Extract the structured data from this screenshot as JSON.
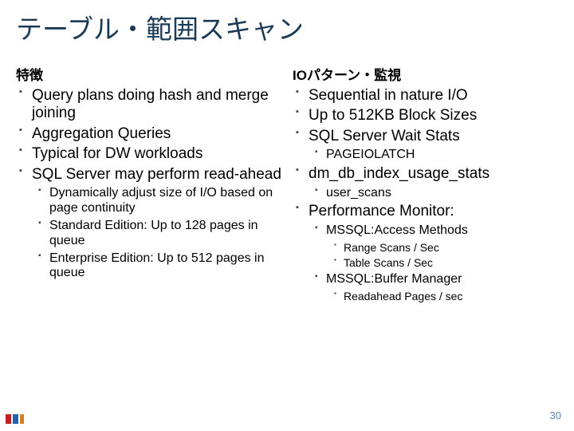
{
  "title": "テーブル・範囲スキャン",
  "left": {
    "heading": "特徴",
    "items": [
      {
        "text": "Query plans doing hash and merge joining"
      },
      {
        "text": "Aggregation Queries"
      },
      {
        "text": "Typical for DW workloads"
      },
      {
        "text": "SQL Server may perform read-ahead",
        "sub": [
          {
            "text": "Dynamically adjust size of I/O based on page continuity"
          },
          {
            "text": "Standard Edition: Up to 128 pages in queue"
          },
          {
            "text": "Enterprise Edition: Up to 512 pages in queue"
          }
        ]
      }
    ]
  },
  "right": {
    "heading": "IOパターン・監視",
    "items": [
      {
        "text": "Sequential in nature I/O"
      },
      {
        "text": "Up to 512KB Block Sizes"
      },
      {
        "text": "SQL Server Wait Stats",
        "sub": [
          {
            "text": "PAGEIOLATCH"
          }
        ]
      },
      {
        "text": "dm_db_index_usage_stats",
        "sub": [
          {
            "text": "user_scans"
          }
        ]
      },
      {
        "text": "Performance Monitor:",
        "sub": [
          {
            "text": "MSSQL:Access Methods",
            "sub": [
              {
                "text": "Range Scans / Sec"
              },
              {
                "text": "Table Scans / Sec"
              }
            ]
          },
          {
            "text": "MSSQL:Buffer Manager",
            "sub": [
              {
                "text": "Readahead Pages / sec"
              }
            ]
          }
        ]
      }
    ]
  },
  "page_number": "30"
}
